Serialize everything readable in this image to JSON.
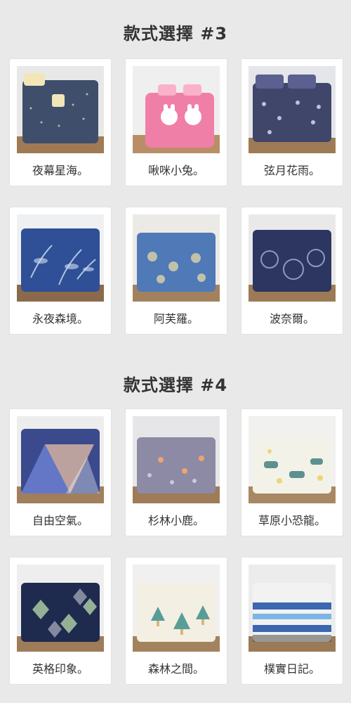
{
  "sections": [
    {
      "title": "款式選擇 #3",
      "products": [
        {
          "name": "夜幕星海。",
          "image": "bedding-photo-navy-starry",
          "colors": {
            "wall": "#e8e8e8",
            "bed": "#3f4e6b",
            "accent": "#f2e6b8",
            "floor": "#a07a55"
          }
        },
        {
          "name": "啾咪小兔。",
          "image": "bedding-photo-pink-bunny",
          "colors": {
            "wall": "#efefef",
            "bed": "#f07fa8",
            "accent": "#ffffff",
            "floor": "#b98e66"
          }
        },
        {
          "name": "弦月花雨。",
          "image": "bedding-photo-navy-floral-moon",
          "colors": {
            "wall": "#e4e6ea",
            "bed": "#40456a",
            "accent": "#dde2ef",
            "floor": "#9e7b57"
          }
        },
        {
          "name": "永夜森境。",
          "image": "bedding-photo-blue-leaves",
          "colors": {
            "wall": "#eef0f2",
            "bed": "#2f4f96",
            "accent": "#cfe0f5",
            "floor": "#8b6a4c"
          }
        },
        {
          "name": "阿芙羅。",
          "image": "bedding-photo-blue-paisley",
          "colors": {
            "wall": "#eceae6",
            "bed": "#4f79b7",
            "accent": "#e7d9a6",
            "floor": "#a3815e"
          }
        },
        {
          "name": "波奈爾。",
          "image": "bedding-photo-navy-damask",
          "colors": {
            "wall": "#e9e9e9",
            "bed": "#2d3561",
            "accent": "#b9c3e8",
            "floor": "#9c7a55"
          }
        }
      ]
    },
    {
      "title": "款式選擇 #4",
      "products": [
        {
          "name": "自由空氣。",
          "image": "bedding-photo-geometric-triangles",
          "colors": {
            "wall": "#ededed",
            "bed": "#3a4a8c",
            "accent": "#f3c8a5",
            "floor": "#a17f5b"
          }
        },
        {
          "name": "杉林小鹿。",
          "image": "bedding-photo-purple-deer",
          "colors": {
            "wall": "#e6e6e8",
            "bed": "#8c8aa4",
            "accent": "#f0a36e",
            "floor": "#9f7b58"
          }
        },
        {
          "name": "草原小恐龍。",
          "image": "bedding-photo-dinosaur",
          "colors": {
            "wall": "#f1f1ef",
            "bed": "#f3f2e8",
            "accent": "#3a7a78",
            "floor": "#a88863"
          }
        },
        {
          "name": "英格印象。",
          "image": "bedding-photo-argyle",
          "colors": {
            "wall": "#eeeeee",
            "bed": "#1f2a4f",
            "accent": "#a9c9a3",
            "floor": "#9e7c59"
          }
        },
        {
          "name": "森林之間。",
          "image": "bedding-photo-trees",
          "colors": {
            "wall": "#f0f0f0",
            "bed": "#f4efe3",
            "accent": "#3f8f8a",
            "floor": "#a3825e"
          }
        },
        {
          "name": "樸實日記。",
          "image": "bedding-photo-stripes",
          "colors": {
            "wall": "#ececec",
            "bed": "#3a67b0",
            "accent": "#f2f2f2",
            "floor": "#9b7a57"
          }
        }
      ]
    }
  ]
}
